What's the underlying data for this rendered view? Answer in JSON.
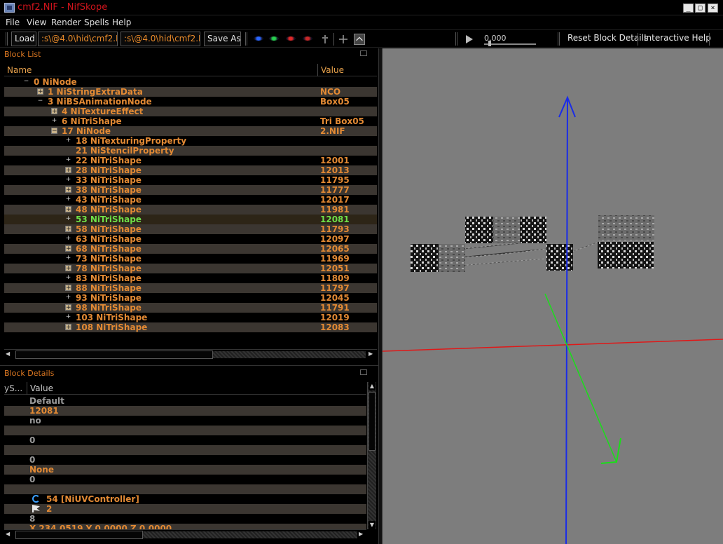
{
  "window": {
    "title": "cmf2.NIF - NifSkope",
    "min_glyph": "_",
    "max_glyph": "□",
    "close_glyph": "×"
  },
  "menu": [
    "File",
    "View",
    "Render",
    "Spells",
    "Help"
  ],
  "toolbar": {
    "load_label": "Load",
    "load_path": ":s\\@4.0\\hid\\cmf2.NIF",
    "save_path": ":s\\@4.0\\hid\\cmf2.NIF",
    "save_as_label": "Save As",
    "time_value": "0.000",
    "reset_label": "Reset Block Details",
    "help_label": "Interactive Help",
    "icons": [
      "view-eye-blue-icon",
      "view-eye-green-icon",
      "view-eye-red-icon",
      "view-eye-red2-icon",
      "walk-icon",
      "axes-icon",
      "flat-view-icon",
      "play-icon"
    ]
  },
  "block_list": {
    "title": "Block List",
    "col_name": "Name",
    "col_value": "Value",
    "rows": [
      {
        "indent": 0,
        "exp": "−",
        "box": false,
        "label": "0 NiNode",
        "value": ""
      },
      {
        "indent": 1,
        "exp": "+",
        "box": true,
        "label": "1 NiStringExtraData",
        "value": "NCO"
      },
      {
        "indent": 1,
        "exp": "−",
        "box": false,
        "label": "3 NiBSAnimationNode",
        "value": "Box05"
      },
      {
        "indent": 2,
        "exp": "+",
        "box": true,
        "label": "4 NiTextureEffect",
        "value": ""
      },
      {
        "indent": 2,
        "exp": "+",
        "box": false,
        "label": "6 NiTriShape",
        "value": "Tri Box05"
      },
      {
        "indent": 2,
        "exp": "−",
        "box": true,
        "label": "17 NiNode",
        "value": "2.NIF"
      },
      {
        "indent": 3,
        "exp": "+",
        "box": false,
        "label": "18 NiTexturingProperty",
        "value": ""
      },
      {
        "indent": 3,
        "exp": "",
        "box": false,
        "label": "21 NiStencilProperty",
        "value": ""
      },
      {
        "indent": 3,
        "exp": "+",
        "box": false,
        "label": "22 NiTriShape",
        "value": "12001"
      },
      {
        "indent": 3,
        "exp": "+",
        "box": true,
        "label": "28 NiTriShape",
        "value": "12013"
      },
      {
        "indent": 3,
        "exp": "+",
        "box": false,
        "label": "33 NiTriShape",
        "value": "11795"
      },
      {
        "indent": 3,
        "exp": "+",
        "box": true,
        "label": "38 NiTriShape",
        "value": "11777"
      },
      {
        "indent": 3,
        "exp": "+",
        "box": false,
        "label": "43 NiTriShape",
        "value": "12017"
      },
      {
        "indent": 3,
        "exp": "+",
        "box": true,
        "label": "48 NiTriShape",
        "value": "11981"
      },
      {
        "indent": 3,
        "exp": "+",
        "box": false,
        "label": "53 NiTriShape",
        "value": "12081",
        "selected": true
      },
      {
        "indent": 3,
        "exp": "+",
        "box": true,
        "label": "58 NiTriShape",
        "value": "11793"
      },
      {
        "indent": 3,
        "exp": "+",
        "box": false,
        "label": "63 NiTriShape",
        "value": "12097"
      },
      {
        "indent": 3,
        "exp": "+",
        "box": true,
        "label": "68 NiTriShape",
        "value": "12065"
      },
      {
        "indent": 3,
        "exp": "+",
        "box": false,
        "label": "73 NiTriShape",
        "value": "11969"
      },
      {
        "indent": 3,
        "exp": "+",
        "box": true,
        "label": "78 NiTriShape",
        "value": "12051"
      },
      {
        "indent": 3,
        "exp": "+",
        "box": false,
        "label": "83 NiTriShape",
        "value": "11809"
      },
      {
        "indent": 3,
        "exp": "+",
        "box": true,
        "label": "88 NiTriShape",
        "value": "11797"
      },
      {
        "indent": 3,
        "exp": "+",
        "box": false,
        "label": "93 NiTriShape",
        "value": "12045"
      },
      {
        "indent": 3,
        "exp": "+",
        "box": true,
        "label": "98 NiTriShape",
        "value": "11791"
      },
      {
        "indent": 3,
        "exp": "+",
        "box": false,
        "label": "103 NiTriShape",
        "value": "12019"
      },
      {
        "indent": 3,
        "exp": "+",
        "box": true,
        "label": "108 NiTriShape",
        "value": "12083"
      }
    ]
  },
  "block_details": {
    "title": "Block Details",
    "col_name": "yS...",
    "col_value": "Value",
    "rows": [
      {
        "text": "Default",
        "grey": true,
        "icon": ""
      },
      {
        "text": "12081",
        "grey": false,
        "icon": ""
      },
      {
        "text": "no",
        "grey": true,
        "icon": ""
      },
      {
        "text": "",
        "grey": false,
        "icon": ""
      },
      {
        "text": "0",
        "grey": true,
        "icon": ""
      },
      {
        "text": "",
        "grey": false,
        "icon": ""
      },
      {
        "text": "0",
        "grey": true,
        "icon": ""
      },
      {
        "text": "None",
        "grey": false,
        "icon": ""
      },
      {
        "text": "0",
        "grey": true,
        "icon": ""
      },
      {
        "text": "",
        "grey": false,
        "icon": ""
      },
      {
        "text": "54 [NiUVController]",
        "grey": false,
        "icon": "controller-link-icon"
      },
      {
        "text": "2",
        "grey": false,
        "icon": "flag-icon"
      },
      {
        "text": "8",
        "grey": true,
        "icon": ""
      },
      {
        "text": "X 234.0519 Y 0.0000 Z 0.0000",
        "grey": false,
        "icon": ""
      }
    ]
  },
  "colors": {
    "accent_orange": "#e38a34",
    "selected_green": "#6ee048",
    "title_red": "#d0141c",
    "viewport_bg": "#7d7d7d",
    "axis_x": "#e01818",
    "axis_y": "#1a2ce8",
    "axis_z": "#18e018"
  }
}
